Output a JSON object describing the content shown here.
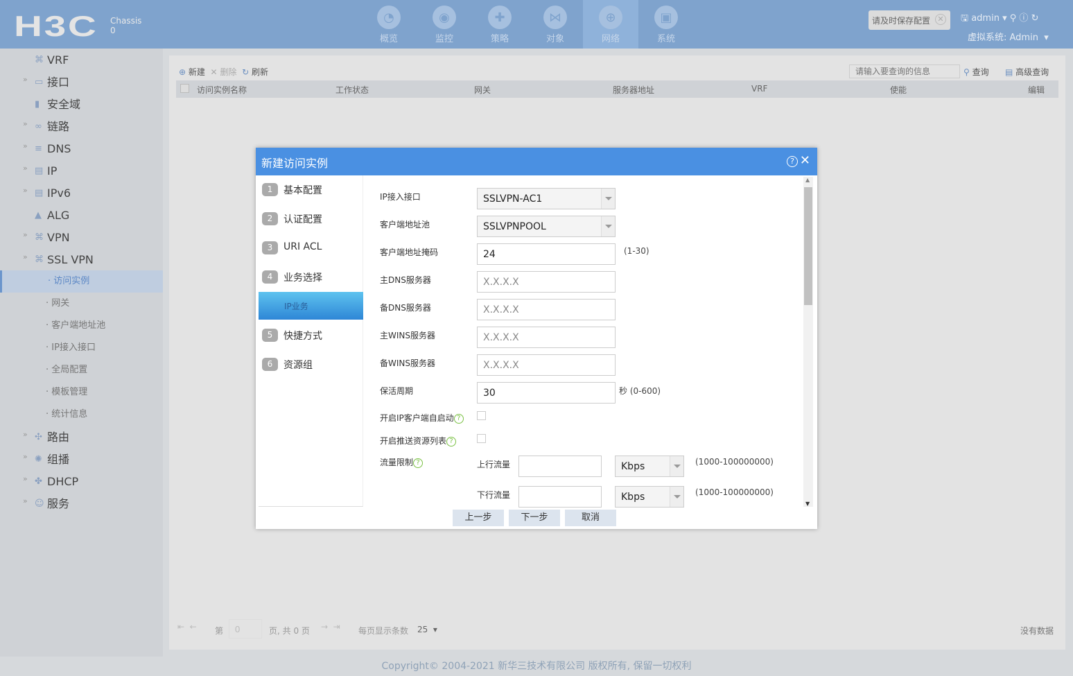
{
  "header": {
    "logo": "H3C",
    "chassis": "Chassis",
    "chassis_no": "0",
    "nav": [
      {
        "label": "概览",
        "icon": "gauge-icon"
      },
      {
        "label": "监控",
        "icon": "monitor-icon"
      },
      {
        "label": "策略",
        "icon": "shield-icon"
      },
      {
        "label": "对象",
        "icon": "share-icon"
      },
      {
        "label": "网络",
        "icon": "globe-icon",
        "active": true
      },
      {
        "label": "系统",
        "icon": "system-icon"
      }
    ],
    "save_tip": "请及时保存配置",
    "user": "admin",
    "vsys": "虚拟系统: Admin"
  },
  "sidebar": {
    "items": [
      {
        "label": "VRF"
      },
      {
        "label": "接口"
      },
      {
        "label": "安全域"
      },
      {
        "label": "链路"
      },
      {
        "label": "DNS"
      },
      {
        "label": "IP"
      },
      {
        "label": "IPv6"
      },
      {
        "label": "ALG"
      },
      {
        "label": "VPN"
      },
      {
        "label": "SSL VPN"
      }
    ],
    "sub": [
      "访问实例",
      "网关",
      "客户端地址池",
      "IP接入接口",
      "全局配置",
      "模板管理",
      "统计信息"
    ],
    "items2": [
      "路由",
      "组播",
      "DHCP",
      "服务"
    ]
  },
  "toolbar": {
    "new": "新建",
    "delete": "删除",
    "refresh": "刷新",
    "search_placeholder": "请输入要查询的信息",
    "query": "查询",
    "advanced": "高级查询"
  },
  "table": {
    "columns": [
      "访问实例名称",
      "工作状态",
      "网关",
      "服务器地址",
      "VRF",
      "使能",
      "编辑"
    ],
    "empty": "没有数据"
  },
  "pager": {
    "page_prefix": "第",
    "page": "0",
    "page_suffix": "页, 共 0 页",
    "per_page_label": "每页显示条数",
    "per_page": "25"
  },
  "footer": "Copyright© 2004-2021 新华三技术有限公司 版权所有, 保留一切权利",
  "dialog": {
    "title": "新建访问实例",
    "steps": [
      {
        "n": "1",
        "label": "基本配置"
      },
      {
        "n": "2",
        "label": "认证配置"
      },
      {
        "n": "3",
        "label": "URI ACL"
      },
      {
        "n": "4",
        "label": "业务选择"
      },
      {
        "n": "",
        "label": "IP业务",
        "active": true
      },
      {
        "n": "5",
        "label": "快捷方式"
      },
      {
        "n": "6",
        "label": "资源组"
      }
    ],
    "fields": [
      {
        "label": "IP接入接口",
        "value": "SSLVPN-AC1",
        "type": "select"
      },
      {
        "label": "客户端地址池",
        "value": "SSLVPNPOOL",
        "type": "select"
      },
      {
        "label": "客户端地址掩码",
        "value": "24",
        "hint": "(1-30)"
      },
      {
        "label": "主DNS服务器",
        "placeholder": "X.X.X.X"
      },
      {
        "label": "备DNS服务器",
        "placeholder": "X.X.X.X"
      },
      {
        "label": "主WINS服务器",
        "placeholder": "X.X.X.X"
      },
      {
        "label": "备WINS服务器",
        "placeholder": "X.X.X.X"
      },
      {
        "label": "保活周期",
        "value": "30",
        "hint": "秒 (0-600)"
      }
    ],
    "auto_start": "开启IP客户端自启动",
    "push_list": "开启推送资源列表",
    "traffic": "流量限制",
    "up": "上行流量",
    "down": "下行流量",
    "unit": "Kbps",
    "range": "(1000-100000000)",
    "prev": "上一步",
    "next": "下一步",
    "cancel": "取消"
  }
}
